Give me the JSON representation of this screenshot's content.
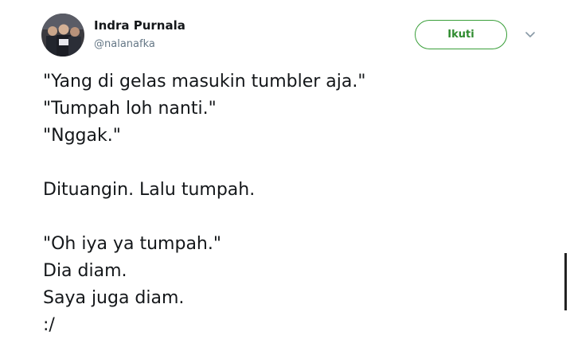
{
  "author": {
    "name": "Indra Purnala",
    "handle": "@nalanafka"
  },
  "actions": {
    "follow_label": "Ikuti",
    "more_icon": "chevron-down-icon"
  },
  "tweet": {
    "lines": [
      "\"Yang di gelas masukin tumbler aja.\"",
      "\"Tumpah loh nanti.\"",
      "\"Nggak.\"",
      "",
      "Dituangin. Lalu tumpah.",
      "",
      "\"Oh iya ya tumpah.\"",
      "Dia diam.",
      "Saya juga diam.",
      ":/"
    ]
  },
  "colors": {
    "follow_accent": "#3a9f3a",
    "text": "#14171a",
    "handle": "#657786"
  }
}
